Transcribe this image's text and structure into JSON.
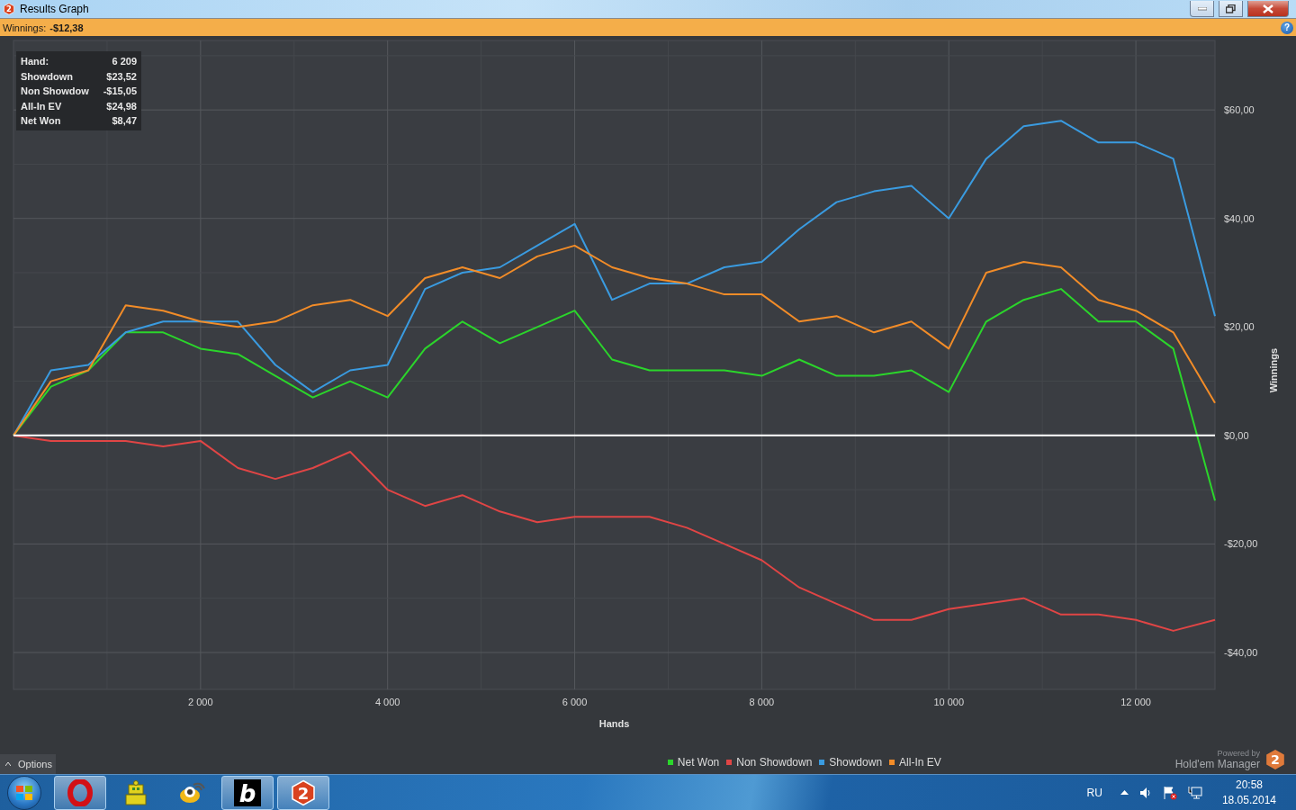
{
  "window": {
    "icon_glyph": "2",
    "title": "Results Graph",
    "help_glyph": "?"
  },
  "summary": {
    "label": "Winnings:",
    "value": "-$12,38"
  },
  "tooltip": {
    "rows": [
      {
        "label": "Hand:",
        "value": "6 209"
      },
      {
        "label": "Showdown",
        "value": "$23,52"
      },
      {
        "label": "Non Showdow",
        "value": "-$15,05"
      },
      {
        "label": "All-In EV",
        "value": "$24,98"
      },
      {
        "label": "Net Won",
        "value": "$8,47"
      }
    ]
  },
  "chart_data": {
    "type": "line",
    "grid": true,
    "xlabel": "Hands",
    "ylabel": "Winnings",
    "xlim": [
      0,
      12846
    ],
    "ylim": [
      -46.8,
      72.8
    ],
    "xticks": [
      {
        "value": 2000,
        "label": "2 000"
      },
      {
        "value": 4000,
        "label": "4 000"
      },
      {
        "value": 6000,
        "label": "6 000"
      },
      {
        "value": 8000,
        "label": "8 000"
      },
      {
        "value": 10000,
        "label": "10 000"
      },
      {
        "value": 12000,
        "label": "12 000"
      }
    ],
    "yticks": [
      {
        "value": -40,
        "label": "-$40,00"
      },
      {
        "value": -20,
        "label": "-$20,00"
      },
      {
        "value": 0,
        "label": "$0,00"
      },
      {
        "value": 20,
        "label": "$20,00"
      },
      {
        "value": 40,
        "label": "$40,00"
      },
      {
        "value": 60,
        "label": "$60,00"
      }
    ],
    "x": [
      0,
      400,
      800,
      1200,
      1600,
      2000,
      2400,
      2800,
      3200,
      3600,
      4000,
      4400,
      4800,
      5200,
      5600,
      6000,
      6400,
      6800,
      7200,
      7600,
      8000,
      8400,
      8800,
      9200,
      9600,
      10000,
      10400,
      10800,
      11200,
      11600,
      12000,
      12400,
      12846
    ],
    "series": [
      {
        "name": "Net Won",
        "color": "#2bd52b",
        "values": [
          0,
          9,
          12,
          19,
          19,
          16,
          15,
          11,
          7,
          10,
          7,
          16,
          21,
          17,
          20,
          23,
          14,
          12,
          12,
          12,
          11,
          14,
          11,
          11,
          12,
          8,
          21,
          25,
          27,
          21,
          21,
          16,
          -12
        ]
      },
      {
        "name": "Non Showdown",
        "color": "#e04545",
        "values": [
          0,
          -1,
          -1,
          -1,
          -2,
          -1,
          -6,
          -8,
          -6,
          -3,
          -10,
          -13,
          -11,
          -14,
          -16,
          -15,
          -15,
          -15,
          -17,
          -20,
          -23,
          -28,
          -31,
          -34,
          -34,
          -32,
          -31,
          -30,
          -33,
          -33,
          -34,
          -36,
          -34
        ]
      },
      {
        "name": "Showdown",
        "color": "#3a9be0",
        "values": [
          0,
          12,
          13,
          19,
          21,
          21,
          21,
          13,
          8,
          12,
          13,
          27,
          30,
          31,
          35,
          39,
          25,
          28,
          28,
          31,
          32,
          38,
          43,
          45,
          46,
          40,
          51,
          57,
          58,
          54,
          54,
          51,
          22
        ]
      },
      {
        "name": "All-In EV",
        "color": "#f28c28",
        "values": [
          0,
          10,
          12,
          24,
          23,
          21,
          20,
          21,
          24,
          25,
          22,
          29,
          31,
          29,
          33,
          35,
          31,
          29,
          28,
          26,
          26,
          21,
          22,
          19,
          21,
          16,
          30,
          32,
          31,
          25,
          23,
          19,
          6
        ]
      }
    ]
  },
  "options": {
    "label": "Options",
    "expanded": false
  },
  "branding": {
    "powered_by": "Powered by",
    "product": "Hold'em Manager",
    "glyph": "2"
  },
  "taskbar": {
    "apps": [
      {
        "kind": "opera",
        "active": true
      },
      {
        "kind": "qip",
        "active": false
      },
      {
        "kind": "messenger",
        "active": false
      },
      {
        "kind": "letter",
        "glyph": "b",
        "active": true
      },
      {
        "kind": "hexagon",
        "glyph": "2",
        "active": true
      }
    ],
    "language": "RU",
    "time": "20:58",
    "date": "18.05.2014"
  }
}
